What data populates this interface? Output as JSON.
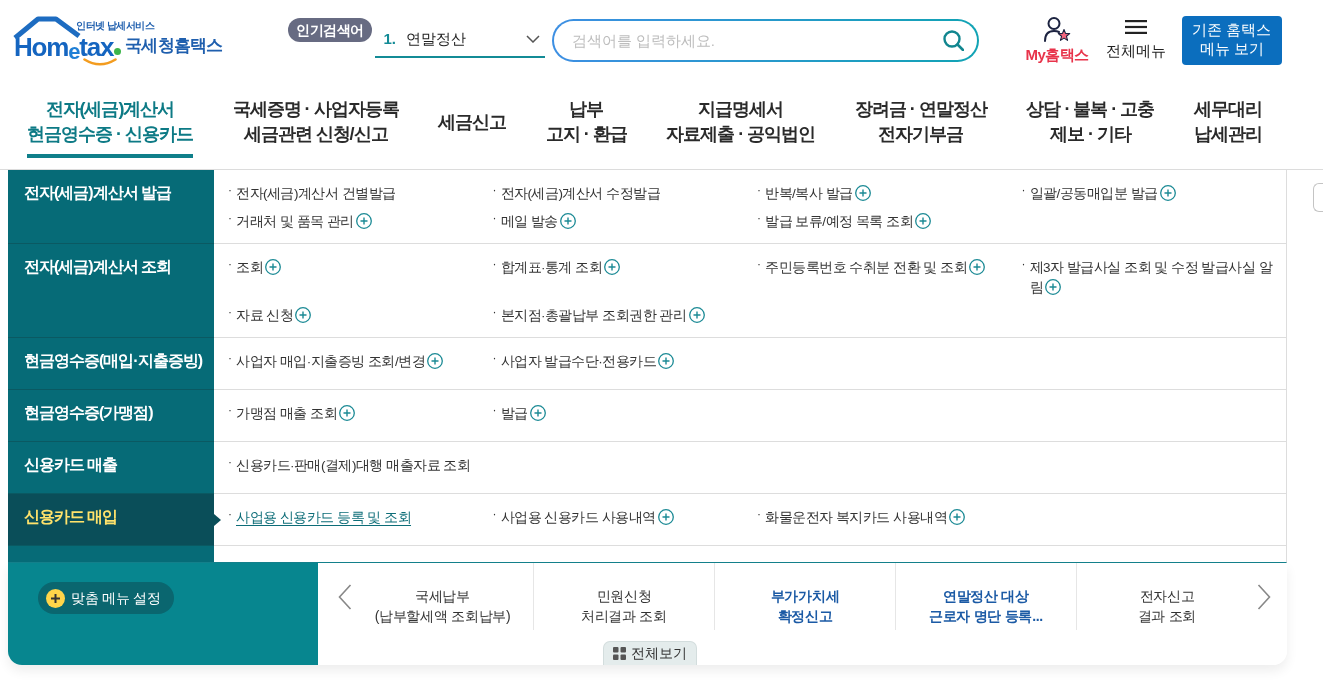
{
  "header": {
    "logo": {
      "tagline": "인터넷 납세서비스",
      "wordmark": "Hom$_{e}$tax",
      "name": "국세청홈택스"
    },
    "popular_search": {
      "label": "인기검색어",
      "rank": "1.",
      "term": "연말정산"
    },
    "search": {
      "placeholder": "검색어를 입력하세요."
    },
    "my_link": "My홈택스",
    "all_menu": "전체메뉴",
    "legacy_button": [
      "기존 홈택스",
      "메뉴 보기"
    ]
  },
  "nav": [
    {
      "lines": [
        "전자(세금)계산서",
        "현금영수증 · 신용카드"
      ],
      "selected": true
    },
    {
      "lines": [
        "국세증명 · 사업자등록",
        "세금관련 신청/신고"
      ],
      "selected": false
    },
    {
      "lines": [
        "세금신고"
      ],
      "selected": false
    },
    {
      "lines": [
        "납부",
        "고지 · 환급"
      ],
      "selected": false
    },
    {
      "lines": [
        "지급명세서",
        "자료제출 · 공익법인"
      ],
      "selected": false
    },
    {
      "lines": [
        "장려금 · 연말정산",
        "전자기부금"
      ],
      "selected": false
    },
    {
      "lines": [
        "상담 · 불복 · 고충",
        "제보 · 기타"
      ],
      "selected": false
    },
    {
      "lines": [
        "세무대리",
        "납세관리"
      ],
      "selected": false
    }
  ],
  "mega_menu": {
    "sections": [
      {
        "title": "전자(세금)계산서 발급",
        "selected": false,
        "items": [
          {
            "marker": "·",
            "label": "전자(세금)계산서 건별발급",
            "submenu": false,
            "selected": false
          },
          {
            "marker": "·",
            "label": "전자(세금)계산서 수정발급",
            "submenu": false,
            "selected": false
          },
          {
            "marker": "·",
            "label": "반복/복사 발급",
            "submenu": true,
            "selected": false
          },
          {
            "marker": "·",
            "label": "일괄/공동매입분 발급",
            "submenu": true,
            "selected": false
          },
          {
            "marker": "·",
            "label": "거래처 및 품목 관리",
            "submenu": true,
            "selected": false
          },
          {
            "marker": "·",
            "label": "메일 발송",
            "submenu": true,
            "selected": false
          },
          {
            "marker": "·",
            "label": "발급 보류/예정 목록 조회",
            "submenu": true,
            "selected": false
          }
        ]
      },
      {
        "title": "전자(세금)계산서 조회",
        "selected": false,
        "items": [
          {
            "marker": "·",
            "label": "조회",
            "submenu": true,
            "selected": false
          },
          {
            "marker": "·",
            "label": "합계표·통계 조회",
            "submenu": true,
            "selected": false
          },
          {
            "marker": "·",
            "label": "주민등록번호 수취분 전환 및 조회",
            "submenu": true,
            "selected": false
          },
          {
            "marker": "·",
            "label": "제3자 발급사실 조회 및 수정 발급사실 알림",
            "submenu": true,
            "selected": false
          },
          {
            "marker": "·",
            "label": "자료 신청",
            "submenu": true,
            "selected": false
          },
          {
            "marker": "·",
            "label": "본지점·총괄납부 조회권한 관리",
            "submenu": true,
            "selected": false
          }
        ]
      },
      {
        "title": "현금영수증(매입·지출증빙)",
        "selected": false,
        "items": [
          {
            "marker": "·",
            "label": "사업자 매입·지출증빙 조회/변경",
            "submenu": true,
            "selected": false
          },
          {
            "marker": "·",
            "label": "사업자 발급수단·전용카드",
            "submenu": true,
            "selected": false
          }
        ]
      },
      {
        "title": "현금영수증(가맹점)",
        "selected": false,
        "items": [
          {
            "marker": "·",
            "label": "가맹점 매출 조회",
            "submenu": true,
            "selected": false
          },
          {
            "marker": "·",
            "label": "발급",
            "submenu": true,
            "selected": false
          }
        ]
      },
      {
        "title": "신용카드 매출",
        "selected": false,
        "items": [
          {
            "marker": "·",
            "label": "신용카드·판매(결제)대행 매출자료 조회",
            "submenu": false,
            "selected": false
          }
        ]
      },
      {
        "title": "신용카드 매입",
        "selected": true,
        "items": [
          {
            "marker": "·",
            "label": "사업용 신용카드 등록 및 조회",
            "submenu": false,
            "selected": true
          },
          {
            "marker": "·",
            "label": "사업용 신용카드 사용내역",
            "submenu": true,
            "selected": false
          },
          {
            "marker": "·",
            "label": "화물운전자 복지카드 사용내역",
            "submenu": true,
            "selected": false
          }
        ]
      }
    ]
  },
  "quick_panel": {
    "custom_button": "맞춤 메뉴 설정",
    "items": [
      {
        "lines": [
          "국세납부",
          "(납부할세액 조회납부)"
        ],
        "emphasized": false
      },
      {
        "lines": [
          "민원신청",
          "처리결과 조회"
        ],
        "emphasized": false
      },
      {
        "lines": [
          "부가가치세",
          "확정신고"
        ],
        "emphasized": true
      },
      {
        "lines": [
          "연말정산 대상",
          "근로자 명단 등록..."
        ],
        "emphasized": true
      },
      {
        "lines": [
          "전자신고",
          "결과 조회"
        ],
        "emphasized": false
      }
    ],
    "view_all": "전체보기"
  }
}
